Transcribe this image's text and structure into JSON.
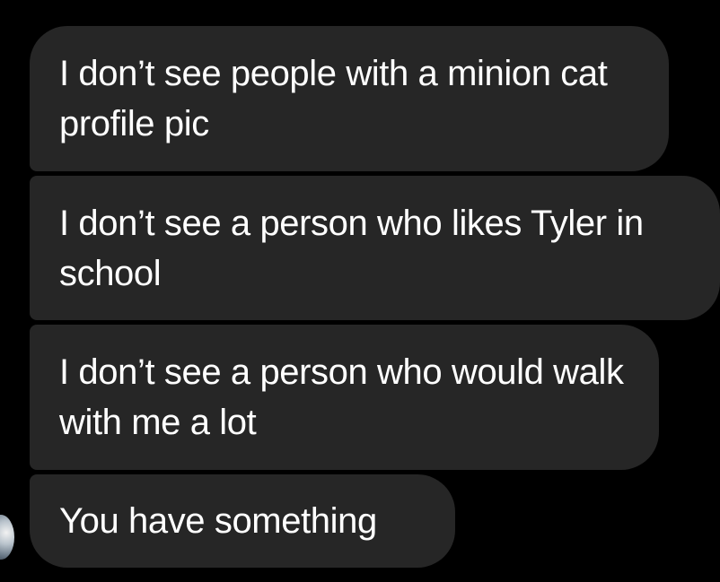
{
  "messages": [
    {
      "text": "I don’t see people with a minion cat profile pic"
    },
    {
      "text": "I don’t see a person who likes Tyler in school"
    },
    {
      "text": "I don’t see a person who would walk with me a lot"
    },
    {
      "text": "You have something"
    }
  ],
  "colors": {
    "background": "#000000",
    "bubble": "#262626",
    "text": "#ffffff"
  }
}
